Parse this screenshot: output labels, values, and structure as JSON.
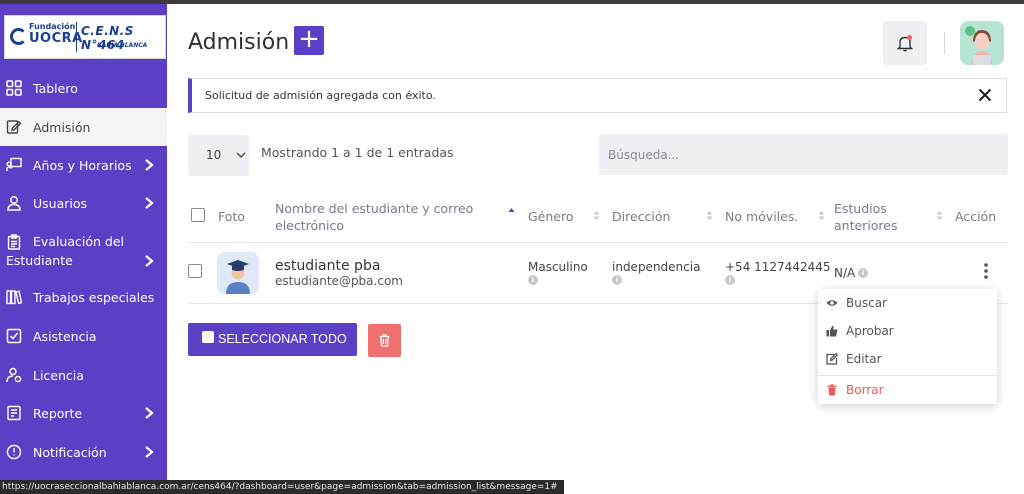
{
  "logo": {
    "fundacion": "Fundación",
    "uocra": "UOCRA",
    "cens": "C.E.N.S N°464",
    "bahia": "BAHÍA BLANCA"
  },
  "sidebar": {
    "items": [
      {
        "label": "Tablero",
        "icon": "dashboard-icon",
        "chevron": false,
        "active": false
      },
      {
        "label": "Admisión",
        "icon": "edit-document-icon",
        "chevron": false,
        "active": true
      },
      {
        "label": "Años y Horarios",
        "icon": "presentation-icon",
        "chevron": true,
        "active": false
      },
      {
        "label": "Usuarios",
        "icon": "user-icon",
        "chevron": true,
        "active": false
      },
      {
        "label": "Evaluación del",
        "label2": "Estudiante",
        "icon": "clipboard-icon",
        "chevron": true,
        "active": false
      },
      {
        "label": "Trabajos especiales",
        "icon": "books-icon",
        "chevron": false,
        "active": false
      },
      {
        "label": "Asistencia",
        "icon": "check-square-icon",
        "chevron": false,
        "active": false
      },
      {
        "label": "Licencia",
        "icon": "user-license-icon",
        "chevron": false,
        "active": false
      },
      {
        "label": "Reporte",
        "icon": "report-icon",
        "chevron": true,
        "active": false
      },
      {
        "label": "Notificación",
        "icon": "notification-icon",
        "chevron": true,
        "active": false
      }
    ]
  },
  "header": {
    "title": "Admisión",
    "add_label": "+"
  },
  "alert": {
    "message": "Solicitud de admisión agregada con éxito."
  },
  "table_controls": {
    "page_length": "10",
    "info": "Mostrando 1 a 1 de 1 entradas",
    "search_placeholder": "Búsqueda..."
  },
  "table": {
    "headers": {
      "photo": "Foto",
      "name_line1": "Nombre del estudiante y correo",
      "name_line2": "electrónico",
      "gender": "Género",
      "address": "Dirección",
      "mobile": "No móviles.",
      "prev_line1": "Estudios",
      "prev_line2": "anteriores",
      "action": "Acción"
    },
    "rows": [
      {
        "name": "estudiante pba",
        "email": "estudiante@pba.com",
        "gender": "Masculino",
        "address": "independencia",
        "mobile": "+54 1127442445",
        "previous_studies": "N/A"
      }
    ]
  },
  "bulk": {
    "select_all_label": "SELECCIONAR TODO"
  },
  "dropdown": {
    "items": [
      {
        "label": "Buscar",
        "icon": "eye-icon"
      },
      {
        "label": "Aprobar",
        "icon": "thumbs-up-icon"
      },
      {
        "label": "Editar",
        "icon": "edit-icon"
      },
      {
        "label": "Borrar",
        "icon": "trash-icon"
      }
    ]
  },
  "statusbar": {
    "url": "https://uocraseccionalbahiablanca.com.ar/cens464/?dashboard=user&page=admission&tab=admission_list&message=1#"
  },
  "colors": {
    "primary": "#5b3fc4",
    "danger": "#f07070",
    "muted_bg": "#eef0f4"
  }
}
